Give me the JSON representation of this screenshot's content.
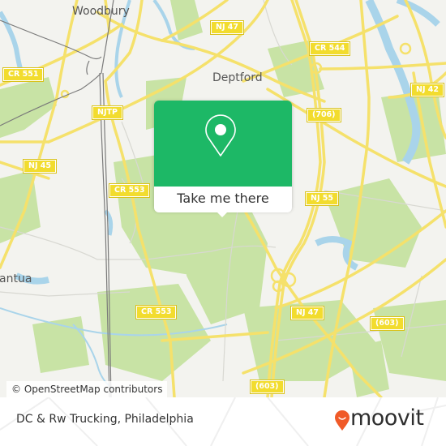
{
  "map": {
    "place_labels": [
      {
        "id": "woodbury",
        "text": "Woodbury"
      },
      {
        "id": "deptford",
        "text": "Deptford"
      },
      {
        "id": "mantua",
        "text": "antua"
      }
    ],
    "road_shields": [
      {
        "id": "nj47-top",
        "text": "NJ 47"
      },
      {
        "id": "cr544",
        "text": "CR 544"
      },
      {
        "id": "cr551",
        "text": "CR 551"
      },
      {
        "id": "nj42",
        "text": "NJ 42"
      },
      {
        "id": "njtp",
        "text": "NJTP"
      },
      {
        "id": "r706",
        "text": "(706)"
      },
      {
        "id": "nj45",
        "text": "NJ 45"
      },
      {
        "id": "cr553-top",
        "text": "CR 553"
      },
      {
        "id": "nj55",
        "text": "NJ 55"
      },
      {
        "id": "cr553-bottom",
        "text": "CR 553"
      },
      {
        "id": "nj47-bottom",
        "text": "NJ 47"
      },
      {
        "id": "r603-right",
        "text": "(603)"
      },
      {
        "id": "r603-bottom",
        "text": "(603)"
      }
    ],
    "attribution": "© OpenStreetMap contributors",
    "colors": {
      "land": "#f3f3ef",
      "park": "#c8e3a5",
      "water": "#a9d4ea",
      "road": "#f5e16b",
      "rail": "#777777"
    }
  },
  "popup": {
    "button_label": "Take me there",
    "icon": "map-pin-icon",
    "color": "#1db866"
  },
  "footer": {
    "title": "DC & Rw Trucking, Philadelphia",
    "logo_text": "moovit",
    "logo_color": "#f05a28"
  }
}
